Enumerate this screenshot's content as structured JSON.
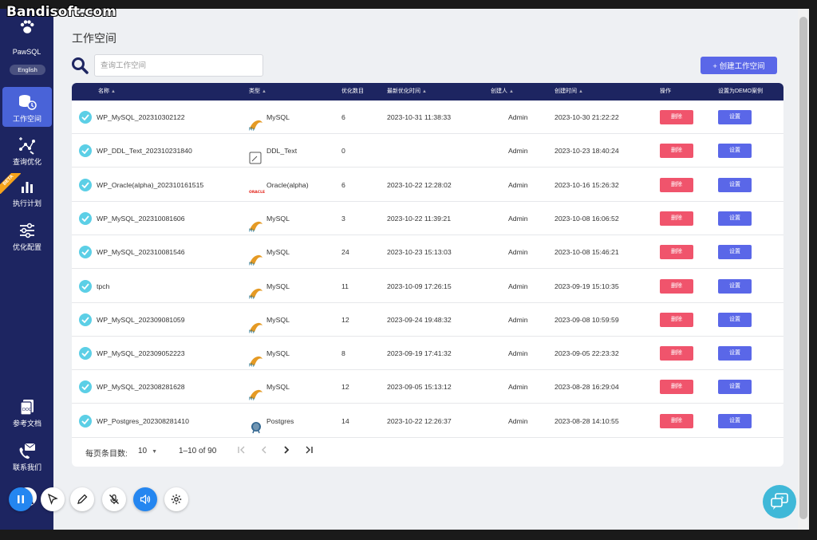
{
  "watermark": "Bandisoft.com",
  "sidebar": {
    "brand": "PawSQL",
    "language_button": "English",
    "beta_badge": "BETA",
    "items": [
      {
        "label": "工作空间",
        "icon": "workspace-icon",
        "active": true
      },
      {
        "label": "查询优化",
        "icon": "query-optimize-icon",
        "active": false
      },
      {
        "label": "执行计划",
        "icon": "bar-chart-icon",
        "active": false
      },
      {
        "label": "优化配置",
        "icon": "sliders-icon",
        "active": false
      }
    ],
    "bottom_items": [
      {
        "label": "参考文档",
        "icon": "document-icon"
      },
      {
        "label": "联系我们",
        "icon": "contact-icon"
      }
    ],
    "accent_color": "#1d2561",
    "active_color": "#4963d8"
  },
  "header": {
    "title": "工作空间",
    "search_placeholder": "查询工作空间",
    "create_button": "+ 创建工作空间"
  },
  "table": {
    "columns": [
      "名称",
      "类型",
      "优化数目",
      "最新优化时间",
      "创建人",
      "创建时间",
      "操作",
      "设置为DEMO案例"
    ],
    "delete_label": "删除",
    "settings_label": "设置",
    "rows": [
      {
        "name": "WP_MySQL_202310302122",
        "type": "MySQL",
        "db": "mysql",
        "count": "6",
        "latest": "2023-10-31 11:38:33",
        "creator": "Admin",
        "created": "2023-10-30 21:22:22"
      },
      {
        "name": "WP_DDL_Text_202310231840",
        "type": "DDL_Text",
        "db": "ddl",
        "count": "0",
        "latest": "",
        "creator": "Admin",
        "created": "2023-10-23 18:40:24"
      },
      {
        "name": "WP_Oracle(alpha)_202310161515",
        "type": "Oracle(alpha)",
        "db": "oracle",
        "count": "6",
        "latest": "2023-10-22 12:28:02",
        "creator": "Admin",
        "created": "2023-10-16 15:26:32"
      },
      {
        "name": "WP_MySQL_202310081606",
        "type": "MySQL",
        "db": "mysql",
        "count": "3",
        "latest": "2023-10-22 11:39:21",
        "creator": "Admin",
        "created": "2023-10-08 16:06:52"
      },
      {
        "name": "WP_MySQL_202310081546",
        "type": "MySQL",
        "db": "mysql",
        "count": "24",
        "latest": "2023-10-23 15:13:03",
        "creator": "Admin",
        "created": "2023-10-08 15:46:21"
      },
      {
        "name": "tpch",
        "type": "MySQL",
        "db": "mysql",
        "count": "11",
        "latest": "2023-10-09 17:26:15",
        "creator": "Admin",
        "created": "2023-09-19 15:10:35"
      },
      {
        "name": "WP_MySQL_202309081059",
        "type": "MySQL",
        "db": "mysql",
        "count": "12",
        "latest": "2023-09-24 19:48:32",
        "creator": "Admin",
        "created": "2023-09-08 10:59:59"
      },
      {
        "name": "WP_MySQL_202309052223",
        "type": "MySQL",
        "db": "mysql",
        "count": "8",
        "latest": "2023-09-19 17:41:32",
        "creator": "Admin",
        "created": "2023-09-05 22:23:32"
      },
      {
        "name": "WP_MySQL_202308281628",
        "type": "MySQL",
        "db": "mysql",
        "count": "12",
        "latest": "2023-09-05 15:13:12",
        "creator": "Admin",
        "created": "2023-08-28 16:29:04"
      },
      {
        "name": "WP_Postgres_202308281410",
        "type": "Postgres",
        "db": "postgres",
        "count": "14",
        "latest": "2023-10-22 12:26:37",
        "creator": "Admin",
        "created": "2023-08-28 14:10:55"
      }
    ]
  },
  "pagination": {
    "per_page_label": "每页条目数:",
    "per_page_value": "10",
    "range": "1–10 of 90"
  },
  "colors": {
    "delete": "#f0546c",
    "primary": "#5a67e8",
    "check": "#5ccfe6"
  }
}
